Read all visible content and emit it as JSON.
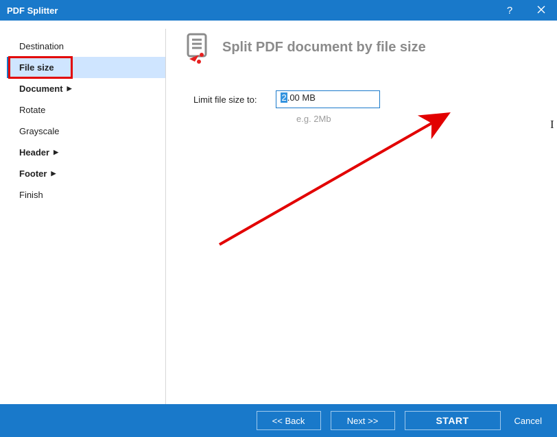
{
  "titlebar": {
    "title": "PDF Splitter"
  },
  "sidebar": {
    "items": [
      {
        "label": "Destination",
        "bold": false,
        "has_arrow": false
      },
      {
        "label": "File size",
        "bold": true,
        "has_arrow": false,
        "selected": true
      },
      {
        "label": "Document",
        "bold": true,
        "has_arrow": true
      },
      {
        "label": "Rotate",
        "bold": false,
        "has_arrow": false
      },
      {
        "label": "Grayscale",
        "bold": false,
        "has_arrow": false
      },
      {
        "label": "Header",
        "bold": true,
        "has_arrow": true
      },
      {
        "label": "Footer",
        "bold": true,
        "has_arrow": true
      },
      {
        "label": "Finish",
        "bold": false,
        "has_arrow": false
      }
    ]
  },
  "content": {
    "heading": "Split PDF document by file size",
    "form": {
      "label": "Limit file size to:",
      "input_value": "2.00 MB",
      "selected_char": "2",
      "rest": ".00 MB",
      "hint": "e.g. 2Mb"
    }
  },
  "footer": {
    "back": "<<  Back",
    "next": "Next  >>",
    "start": "START",
    "cancel": "Cancel"
  },
  "arrow_text": "▶"
}
